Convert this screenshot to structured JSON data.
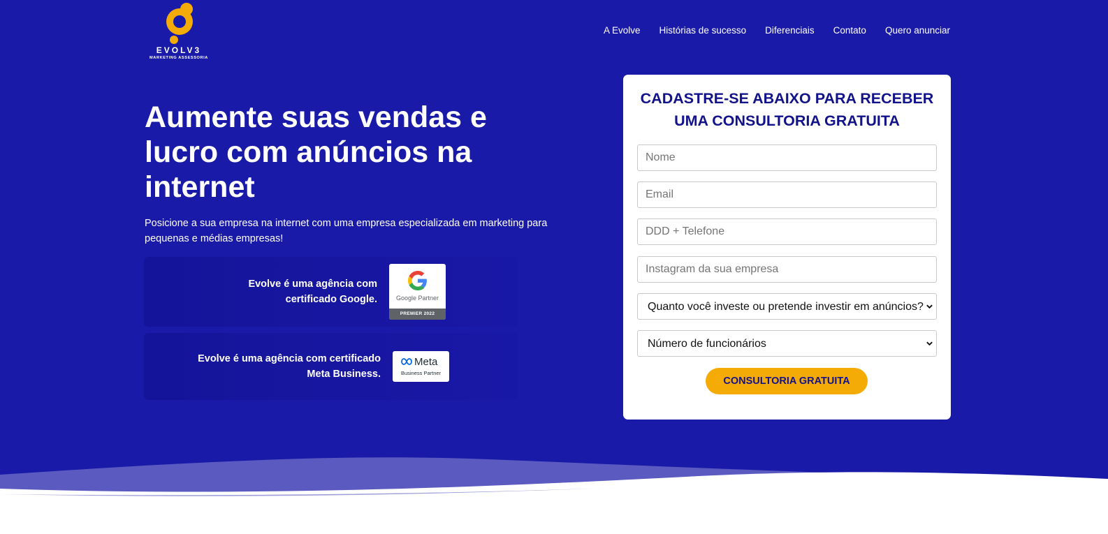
{
  "brand": {
    "name": "EVOLV3",
    "tagline": "MARKETING ASSESSORIA"
  },
  "nav": {
    "items": [
      "A Evolve",
      "Histórias de sucesso",
      "Diferenciais",
      "Contato",
      "Quero anunciar"
    ]
  },
  "hero": {
    "headline": "Aumente suas vendas e lucro com anúncios na internet",
    "subheadline": "Posicione a sua empresa na internet com uma empresa especializada em marketing para pequenas e médias empresas!"
  },
  "certs": {
    "google": {
      "text": "Evolve é uma agência com certificado Google.",
      "badge_label": "Google Partner",
      "badge_level": "PREMIER 2022"
    },
    "meta": {
      "text": "Evolve é uma agência com certificado Meta Business.",
      "badge_word": "Meta",
      "badge_label": "Business Partner"
    }
  },
  "form": {
    "title": "CADASTRE-SE ABAIXO PARA RECEBER UMA CONSULTORIA GRATUITA",
    "name_placeholder": "Nome",
    "email_placeholder": "Email",
    "phone_placeholder": "DDD + Telefone",
    "instagram_placeholder": "Instagram da sua empresa",
    "investment_select": "Quanto você investe ou pretende investir em anúncios?",
    "employees_select": "Número de funcionários",
    "submit_label": "CONSULTORIA GRATUITA"
  },
  "colors": {
    "hero_bg": "#1a1aa8",
    "accent": "#f5ab06",
    "title_text": "#12128a",
    "wave_light": "#5a5ac0"
  },
  "icons": [
    "evolve-logo-icon",
    "google-g-icon",
    "meta-infinity-icon",
    "chevron-down-icon"
  ]
}
